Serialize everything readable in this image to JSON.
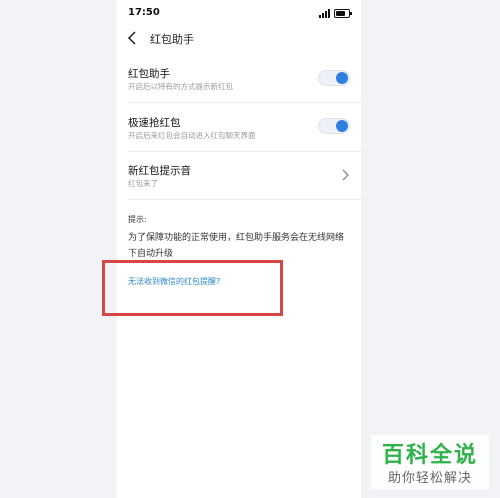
{
  "status_bar": {
    "time": "17:50"
  },
  "nav": {
    "title": "红包助手"
  },
  "settings": [
    {
      "title": "红包助手",
      "subtitle": "开启后以特有的方式提示新红包",
      "toggle_on": true
    },
    {
      "title": "极速抢红包",
      "subtitle": "开启后来红包会自动进入红包聊天界面",
      "toggle_on": true
    },
    {
      "title": "新红包提示音",
      "subtitle": "红包来了"
    }
  ],
  "notice": {
    "label": "提示:",
    "text": "为了保障功能的正常使用，红包助手服务会在无线网络下自动升级",
    "link": "无法收到微信的红包提醒?"
  },
  "watermark": {
    "title": "百科全说",
    "subtitle": "助你轻松解决"
  },
  "colors": {
    "accent": "#2f7fe2",
    "link": "#2a88c8",
    "highlight": "#d64646",
    "watermark": "#2db34a"
  }
}
